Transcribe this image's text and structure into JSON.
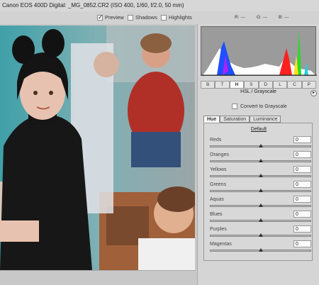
{
  "title": "Canon EOS 400D Digital:  _MG_0852.CR2  (ISO 400, 1/60, f/2.0, 50 mm)",
  "options": {
    "preview": {
      "label": "Preview",
      "checked": true
    },
    "shadows": {
      "label": "Shadows",
      "checked": false
    },
    "highlights": {
      "label": "Highlights",
      "checked": false
    }
  },
  "readout": {
    "r": "R: ---",
    "g": "G: ---",
    "b": "B: ---"
  },
  "panel_tabs": [
    "B",
    "T",
    "H",
    "S",
    "D",
    "L",
    "C",
    "P"
  ],
  "active_tab": "H",
  "section_title": "HSL / Grayscale",
  "convert_label": "Convert to Grayscale",
  "sub_tabs": [
    "Hue",
    "Saturation",
    "Luminance"
  ],
  "active_sub_tab": "Hue",
  "default_label": "Default",
  "sliders": [
    {
      "label": "Reds",
      "value": "0",
      "level": 0.5
    },
    {
      "label": "Oranges",
      "value": "0",
      "level": 0.5
    },
    {
      "label": "Yellows",
      "value": "0",
      "level": 0.5
    },
    {
      "label": "Greens",
      "value": "0",
      "level": 0.5
    },
    {
      "label": "Aquas",
      "value": "0",
      "level": 0.5
    },
    {
      "label": "Blues",
      "value": "0",
      "level": 0.5
    },
    {
      "label": "Purples",
      "value": "0",
      "level": 0.5
    },
    {
      "label": "Magentas",
      "value": "0",
      "level": 0.5
    }
  ],
  "colors": {
    "histogram_bg": "#9b9b9b",
    "panel_bg": "#d5d5d5"
  }
}
